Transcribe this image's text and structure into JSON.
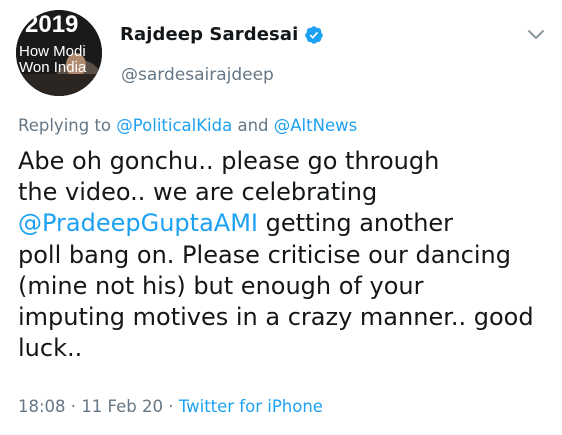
{
  "author": {
    "avatar_text": {
      "line1": "2019",
      "line2": "How Modi",
      "line3": "Won India"
    },
    "display_name": "Rajdeep Sardesai",
    "handle": "@sardesairajdeep",
    "verified_icon": "verified-badge-icon",
    "verified_color": "#1da1f2"
  },
  "menu_icon": "chevron-down-icon",
  "reply": {
    "prefix": "Replying to ",
    "mention1": "@PoliticalKida",
    "joiner": " and ",
    "mention2": "@AltNews"
  },
  "tweet": {
    "line1": "Abe oh gonchu.. please go through",
    "line2": "the video.. we are celebrating",
    "line3_mention": "@PradeepGuptaAMI",
    "line3_rest": " getting another",
    "line4": "poll bang on. Please criticise our dancing",
    "line5": "(mine not his) but enough of your",
    "line6": "imputing motives in a crazy manner.. good",
    "line7": "luck.."
  },
  "meta": {
    "time": "18:08",
    "sep1": " · ",
    "date": "11 Feb 20",
    "sep2": " · ",
    "source": "Twitter for iPhone"
  },
  "colors": {
    "link": "#1da1f2",
    "secondary_text": "#657786",
    "primary_text": "#14171a"
  }
}
